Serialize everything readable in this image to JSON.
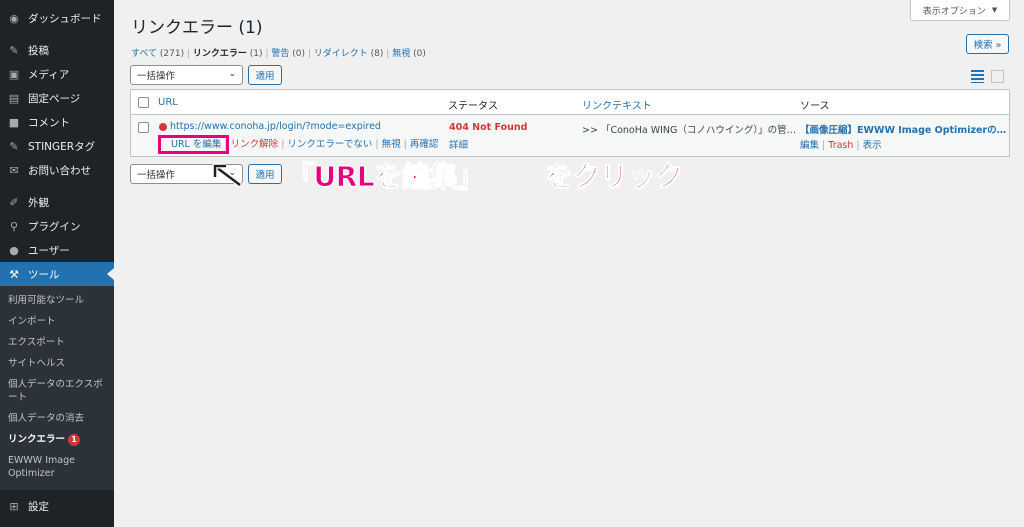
{
  "sidebar": {
    "items": [
      {
        "label": "ダッシュボード",
        "icon": "dashboard-icon"
      },
      {
        "label": "投稿",
        "icon": "pin-icon"
      },
      {
        "label": "メディア",
        "icon": "media-icon"
      },
      {
        "label": "固定ページ",
        "icon": "page-icon"
      },
      {
        "label": "コメント",
        "icon": "comment-icon"
      },
      {
        "label": "STINGERタグ",
        "icon": "pin-icon"
      },
      {
        "label": "お問い合わせ",
        "icon": "mail-icon"
      },
      {
        "label": "外観",
        "icon": "brush-icon"
      },
      {
        "label": "プラグイン",
        "icon": "plugin-icon"
      },
      {
        "label": "ユーザー",
        "icon": "user-icon"
      },
      {
        "label": "ツール",
        "icon": "wrench-icon"
      }
    ],
    "submenu": [
      "利用可能なツール",
      "インポート",
      "エクスポート",
      "サイトヘルス",
      "個人データのエクスポート",
      "個人データの消去",
      "リンクエラー",
      "EWWW Image Optimizer"
    ],
    "badge": "1",
    "settings": "設定"
  },
  "header": {
    "title": "リンクエラー (1)",
    "screen_options": "表示オプション",
    "search_button": "検索 »"
  },
  "filters": {
    "all": "すべて",
    "all_count": "(271)",
    "broken": "リンクエラー",
    "broken_count": "(1)",
    "warnings": "警告",
    "warnings_count": "(0)",
    "redirects": "リダイレクト",
    "redirects_count": "(8)",
    "ignored": "無視",
    "ignored_count": "(0)"
  },
  "bulk": {
    "label": "一括操作",
    "apply": "適用"
  },
  "table": {
    "headers": {
      "url": "URL",
      "status": "ステータス",
      "link_text": "リンクテキスト",
      "source": "ソース"
    },
    "row": {
      "url": "https://www.conoha.jp/login/?mode=expired",
      "actions": [
        "URL を編集",
        "リンク解除",
        "リンクエラーでない",
        "無視",
        "再確認"
      ],
      "status": "404 Not Found",
      "details": "詳細",
      "link_text": ">> 「ConoHa WING（コノハウイング）」の管…",
      "source": "【画像圧縮】EWWW Image Optimizerの…",
      "source_actions": [
        "編集",
        "Trash",
        "表示"
      ]
    }
  },
  "annotation": {
    "part1": "「URLを編集」",
    "part2": "をクリック"
  },
  "colors": {
    "sidebar": "#1d2327",
    "accent": "#2271b1",
    "annotation": "#e6007e",
    "error": "#d63638"
  }
}
